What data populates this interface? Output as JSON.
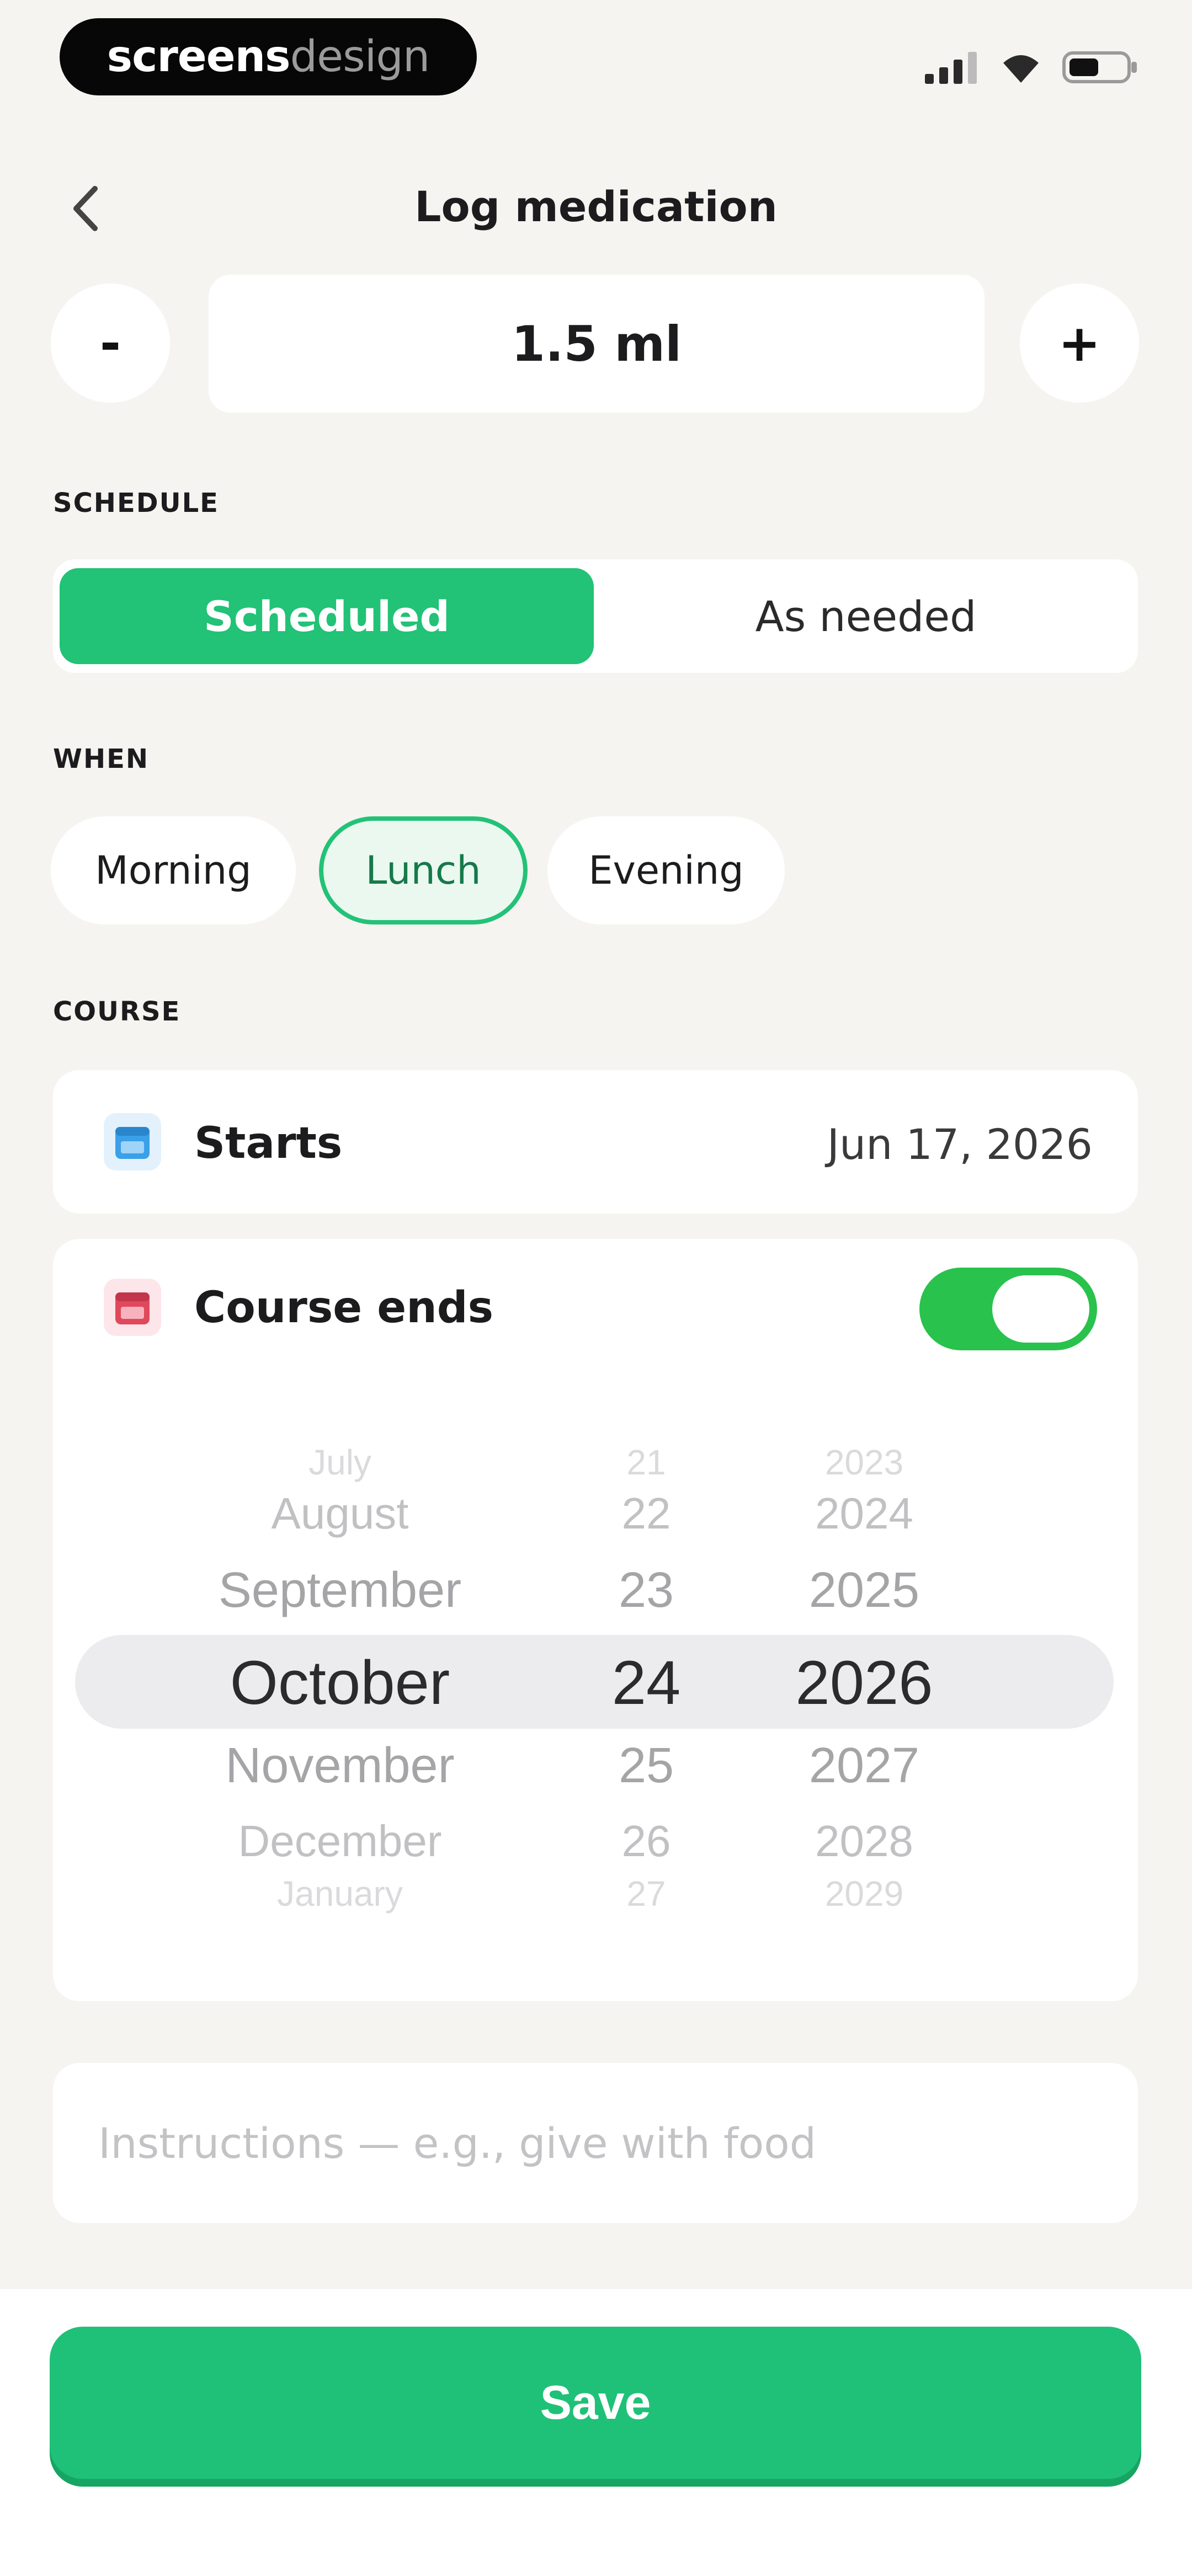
{
  "status_bar": {
    "brand_bold": "screens",
    "brand_light": "design",
    "icons": [
      "signal-icon",
      "wifi-icon",
      "battery-icon"
    ]
  },
  "header": {
    "title": "Log medication",
    "back_icon": "chevron-left-icon"
  },
  "dose": {
    "value": "1.5 ml",
    "decrement_label": "-",
    "increment_label": "+"
  },
  "schedule": {
    "label": "SCHEDULE",
    "options": [
      "Scheduled",
      "As needed"
    ],
    "selected": "Scheduled"
  },
  "when": {
    "label": "WHEN",
    "options": [
      "Morning",
      "Lunch",
      "Evening"
    ],
    "selected": "Lunch"
  },
  "course": {
    "label": "COURSE",
    "starts_label": "Starts",
    "starts_value": "Jun 17, 2026",
    "ends_label": "Course ends",
    "ends_enabled": true,
    "picker": {
      "months": [
        "July",
        "August",
        "September",
        "October",
        "November",
        "December",
        "January"
      ],
      "days": [
        "21",
        "22",
        "23",
        "24",
        "25",
        "26",
        "27"
      ],
      "years": [
        "2023",
        "2024",
        "2025",
        "2026",
        "2027",
        "2028",
        "2029"
      ],
      "selected": {
        "month": "October",
        "day": "24",
        "year": "2026"
      }
    }
  },
  "instructions": {
    "placeholder": "Instructions — e.g., give with food",
    "value": ""
  },
  "save_label": "Save",
  "colors": {
    "accent_green": "#22c277",
    "toggle_green": "#28c24d",
    "background": "#f6f4f0",
    "starts_icon_blue": "#3aa0e8",
    "ends_icon_red": "#e0485b"
  }
}
